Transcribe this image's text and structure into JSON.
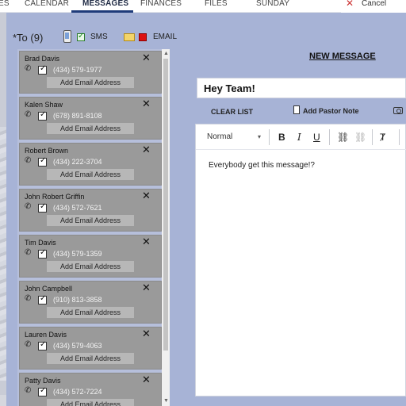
{
  "nav": {
    "tabs": [
      {
        "label": "ES"
      },
      {
        "label": "CALENDAR"
      },
      {
        "label": "MESSAGES"
      },
      {
        "label": "FINANCES"
      },
      {
        "label": "FILES"
      },
      {
        "label": "SUNDAY"
      }
    ],
    "active_tab": "MESSAGES",
    "cancel_label": "Cancel"
  },
  "compose": {
    "to_label": "*To (9)",
    "sms_label": "SMS",
    "email_label": "EMAIL",
    "sms_checked": true,
    "email_checked": false,
    "title": "NEW MESSAGE",
    "subject": "Hey Team!",
    "clear_list": "CLEAR LIST",
    "add_note": "Add Pastor Note",
    "format": "Normal",
    "body": "Everybody get this message!?"
  },
  "recipients": [
    {
      "name": "Brad Davis",
      "phone": "(434) 579-1977",
      "action": "Add Email Address"
    },
    {
      "name": "Kalen Shaw",
      "phone": "(678) 891-8108",
      "action": "Add Email Address"
    },
    {
      "name": "Robert Brown",
      "phone": "(434) 222-3704",
      "action": "Add Email Address"
    },
    {
      "name": "John Robert Griffin",
      "phone": "(434) 572-7621",
      "action": "Add Email Address"
    },
    {
      "name": "Tim Davis",
      "phone": "(434) 579-1359",
      "action": "Add Email Address"
    },
    {
      "name": "John Campbell",
      "phone": "(910) 813-3858",
      "action": "Add Email Address"
    },
    {
      "name": "Lauren Davis",
      "phone": "(434) 579-4063",
      "action": "Add Email Address"
    },
    {
      "name": "Patty Davis",
      "phone": "(434) 572-7224",
      "action": "Add Email Address"
    }
  ],
  "icons": {
    "phone": "phone-icon",
    "close": "close-icon",
    "envelope": "envelope-icon",
    "camera": "camera-icon",
    "document": "document-icon"
  }
}
